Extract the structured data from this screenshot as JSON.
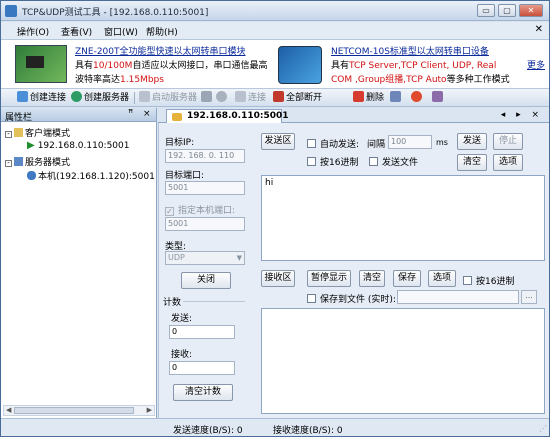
{
  "window": {
    "title": "TCP&UDP测试工具 - [192.168.0.110:5001]",
    "buttons": [
      "▭",
      "▢",
      "✕"
    ]
  },
  "menubar": {
    "items": [
      "操作(O)",
      "查看(V)",
      "窗口(W)",
      "帮助(H)"
    ],
    "close": "✕"
  },
  "banner": {
    "ad1": {
      "title": "ZNE-200T全功能型快速以太网转串口模块",
      "line2_a": "具有",
      "line2_b": "10/100M",
      "line2_c": "自适应以太网接口，串口通信最高",
      "line3_a": "波特率高达",
      "line3_b": "1.15Mbps"
    },
    "ad2": {
      "title": "NETCOM-10S标准型以太网转串口设备",
      "line2_a": "具有",
      "line2_b": "TCP Server,TCP Client, UDP, Real",
      "line3_a": "COM ,Group组播,TCP Auto",
      "line3_b": "等多种工作模式"
    },
    "more": "更多"
  },
  "toolbar": {
    "create_connection": "创建连接",
    "create_server": "创建服务器",
    "start_server": "启动服务器",
    "connect": "连接",
    "disconnect_all": "全部断开",
    "delete": "删除"
  },
  "sidebar": {
    "title": "属性栏",
    "pin": "ꟸ",
    "close": "×",
    "client_mode": "客户端模式",
    "client_item": "192.168.0.110:5001",
    "server_mode": "服务器模式",
    "server_item": "本机(192.168.1.120):5001"
  },
  "tab": {
    "label": "192.168.0.110:5001",
    "nav": "◂ ▸ ×"
  },
  "config": {
    "target_ip_label": "目标IP:",
    "target_ip_value": "192. 168. 0. 110",
    "target_port_label": "目标端口:",
    "target_port_value": "5001",
    "specify_local_port": "指定本机端口:",
    "local_port_value": "5001",
    "type_label": "类型:",
    "type_value": "UDP",
    "close_button": "关闭",
    "count_label": "计数",
    "send_label": "发送:",
    "send_count": "0",
    "receive_label": "接收:",
    "receive_count": "0",
    "clear_count_button": "清空计数"
  },
  "send_area": {
    "label": "发送区",
    "auto_send": "自动发送:",
    "interval_label": "间隔",
    "interval_value": "100",
    "interval_unit": "ms",
    "send_button": "发送",
    "stop_button": "停止",
    "hex_label": "按16进制",
    "send_file_label": "发送文件",
    "clear_button": "清空",
    "options_button": "选项",
    "text": "hi"
  },
  "receive_area": {
    "label": "接收区",
    "pause_button": "暂停显示",
    "clear_button": "清空",
    "save_button": "保存",
    "options_button": "选项",
    "hex_label": "按16进制",
    "save_to_file": "保存到文件 (实时):",
    "browse": "..."
  },
  "statusbar": {
    "send_speed": "发送速度(B/S): 0",
    "receive_speed": "接收速度(B/S): 0"
  }
}
